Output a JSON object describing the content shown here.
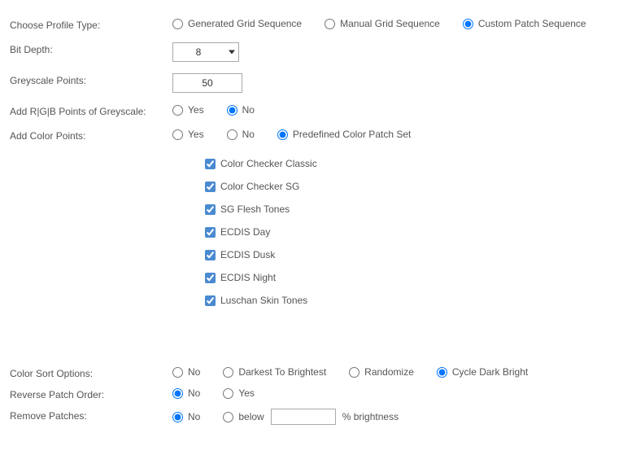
{
  "profile_type": {
    "label": "Choose Profile Type:",
    "options": [
      "Generated Grid Sequence",
      "Manual Grid Sequence",
      "Custom Patch Sequence"
    ],
    "selected": 2
  },
  "bit_depth": {
    "label": "Bit Depth:",
    "value": "8"
  },
  "greyscale_points": {
    "label": "Greyscale Points:",
    "value": "50"
  },
  "add_rgb": {
    "label": "Add R|G|B Points of Greyscale:",
    "options": [
      "Yes",
      "No"
    ],
    "selected": 1
  },
  "add_color": {
    "label": "Add Color Points:",
    "options": [
      "Yes",
      "No",
      "Predefined Color Patch Set"
    ],
    "selected": 2,
    "checkboxes": [
      {
        "label": "Color Checker Classic",
        "checked": true
      },
      {
        "label": "Color Checker SG",
        "checked": true
      },
      {
        "label": "SG Flesh Tones",
        "checked": true
      },
      {
        "label": "ECDIS Day",
        "checked": true
      },
      {
        "label": "ECDIS Dusk",
        "checked": true
      },
      {
        "label": "ECDIS Night",
        "checked": true
      },
      {
        "label": "Luschan Skin Tones",
        "checked": true
      }
    ]
  },
  "color_sort": {
    "label": "Color Sort Options:",
    "options": [
      "No",
      "Darkest To Brightest",
      "Randomize",
      "Cycle Dark Bright"
    ],
    "selected": 3
  },
  "reverse_patch": {
    "label": "Reverse Patch Order:",
    "options": [
      "No",
      "Yes"
    ],
    "selected": 0
  },
  "remove_patches": {
    "label": "Remove Patches:",
    "options": [
      "No",
      "below"
    ],
    "selected": 0,
    "value": "",
    "suffix": "% brightness"
  }
}
